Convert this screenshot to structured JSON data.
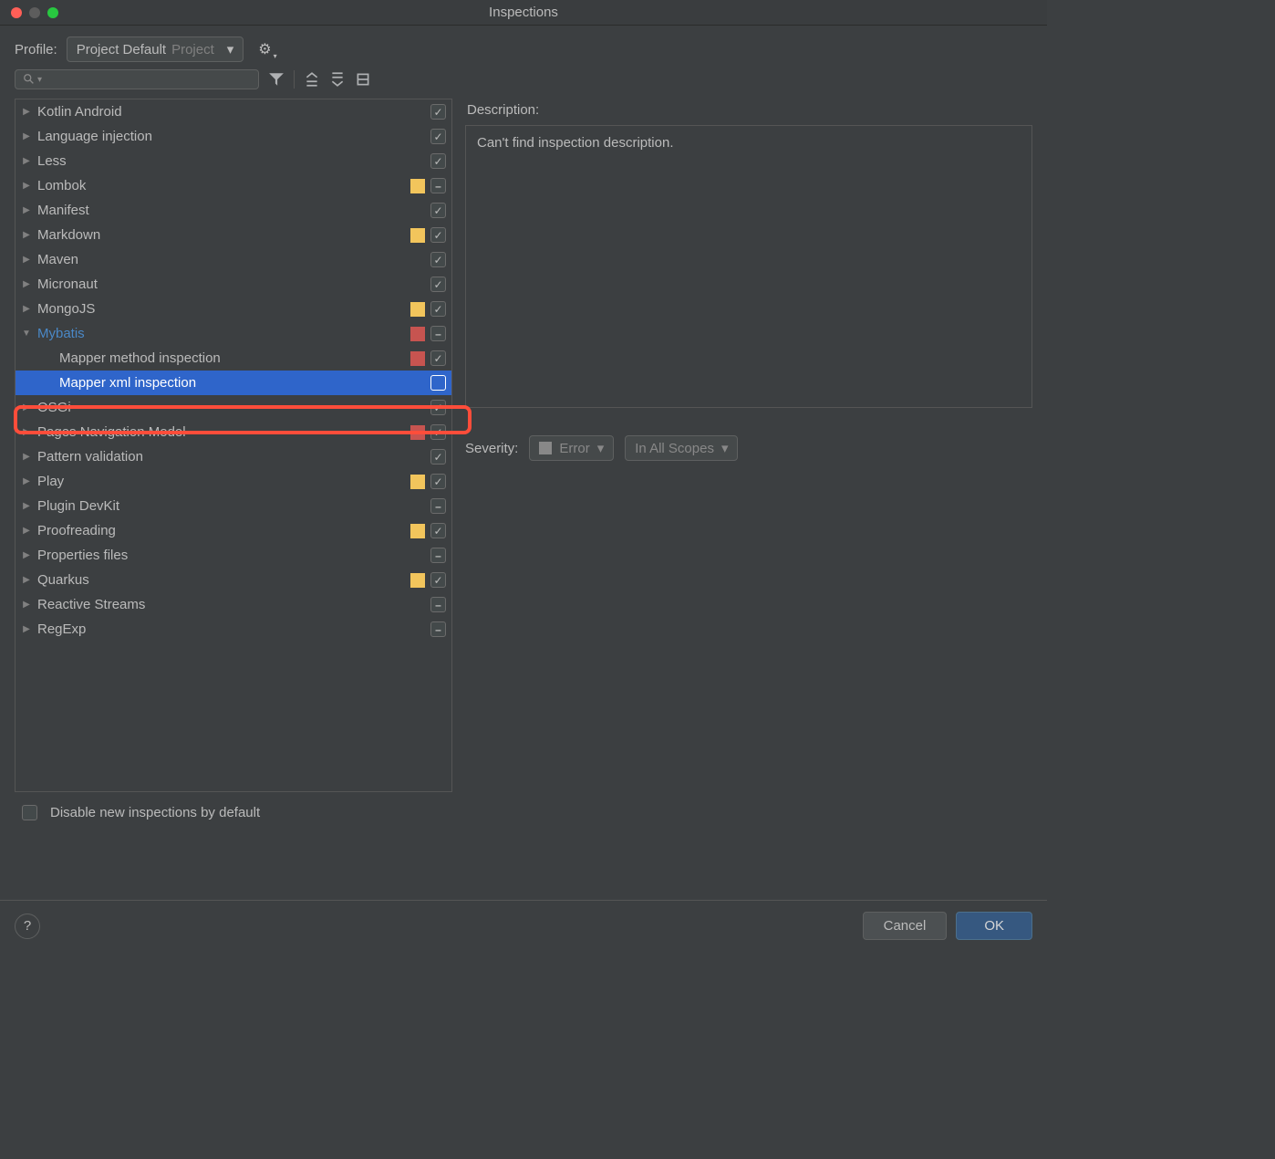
{
  "window": {
    "title": "Inspections"
  },
  "profile": {
    "label": "Profile:",
    "value": "Project Default",
    "scope": "Project"
  },
  "tree": [
    {
      "label": "Kotlin Android",
      "expanded": false,
      "status": null,
      "check": "checked"
    },
    {
      "label": "Language injection",
      "expanded": false,
      "status": null,
      "check": "checked"
    },
    {
      "label": "Less",
      "expanded": false,
      "status": null,
      "check": "checked"
    },
    {
      "label": "Lombok",
      "expanded": false,
      "status": "yellow",
      "check": "dash"
    },
    {
      "label": "Manifest",
      "expanded": false,
      "status": null,
      "check": "checked"
    },
    {
      "label": "Markdown",
      "expanded": false,
      "status": "yellow",
      "check": "checked"
    },
    {
      "label": "Maven",
      "expanded": false,
      "status": null,
      "check": "checked"
    },
    {
      "label": "Micronaut",
      "expanded": false,
      "status": null,
      "check": "checked"
    },
    {
      "label": "MongoJS",
      "expanded": false,
      "status": "yellow",
      "check": "checked"
    },
    {
      "label": "Mybatis",
      "expanded": true,
      "status": "red",
      "check": "dash",
      "highlight": true
    },
    {
      "label": "Mapper method inspection",
      "child": true,
      "status": "red",
      "check": "checked"
    },
    {
      "label": "Mapper xml inspection",
      "child": true,
      "status": null,
      "check": "none",
      "selected": true
    },
    {
      "label": "OSGi",
      "expanded": false,
      "status": null,
      "check": "checked"
    },
    {
      "label": "Pages Navigation Model",
      "expanded": false,
      "status": "red",
      "check": "checked"
    },
    {
      "label": "Pattern validation",
      "expanded": false,
      "status": null,
      "check": "checked"
    },
    {
      "label": "Play",
      "expanded": false,
      "status": "yellow",
      "check": "checked"
    },
    {
      "label": "Plugin DevKit",
      "expanded": false,
      "status": null,
      "check": "dash"
    },
    {
      "label": "Proofreading",
      "expanded": false,
      "status": "yellow",
      "check": "checked"
    },
    {
      "label": "Properties files",
      "expanded": false,
      "status": null,
      "check": "dash"
    },
    {
      "label": "Quarkus",
      "expanded": false,
      "status": "yellow",
      "check": "checked"
    },
    {
      "label": "Reactive Streams",
      "expanded": false,
      "status": null,
      "check": "dash"
    },
    {
      "label": "RegExp",
      "expanded": false,
      "status": null,
      "check": "dash"
    }
  ],
  "description": {
    "label": "Description:",
    "text": "Can't find inspection description."
  },
  "severity": {
    "label": "Severity:",
    "value": "Error",
    "scope": "In All Scopes"
  },
  "disable_new": {
    "label": "Disable new inspections by default",
    "checked": false
  },
  "buttons": {
    "help": "?",
    "cancel": "Cancel",
    "ok": "OK"
  }
}
